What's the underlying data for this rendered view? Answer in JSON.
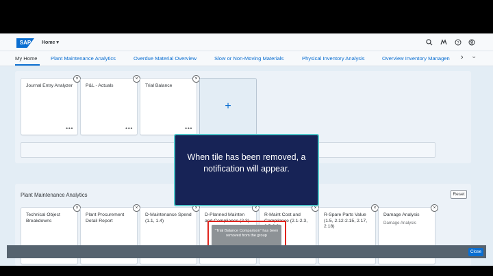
{
  "shell": {
    "logo": "SAP",
    "home_label": "Home ▾",
    "icons": [
      "search-icon",
      "feedback-icon",
      "help-icon",
      "user-icon"
    ]
  },
  "nav": {
    "tabs": [
      "My Home",
      "Plant Maintenance Analytics",
      "Overdue Material Overview",
      "Slow or Non-Moving Materials",
      "Physical Inventory Analysis",
      "Overview Inventory Managen"
    ],
    "overflow_more": "›",
    "overflow_down": "⌄"
  },
  "group1": {
    "tiles": [
      {
        "title": "Journal Entry Analyzer",
        "more": "•••"
      },
      {
        "title": "P&L - Actuals",
        "more": "•••"
      },
      {
        "title": "Trial Balance",
        "more": "•••"
      }
    ],
    "add_tile": "+"
  },
  "group2": {
    "title": "Plant Maintenance Analytics",
    "reset": "Reset",
    "tiles": [
      {
        "title": "Technical Object Breakdowns",
        "subtitle": ""
      },
      {
        "title": "Plant Procurement Detail Report",
        "subtitle": ""
      },
      {
        "title": "D-Maintenance Spend (1.1, 1.4)",
        "subtitle": ""
      },
      {
        "title": "D-Planned Mainten and Compliance (2.3)",
        "subtitle": ""
      },
      {
        "title": "R-Maint Cost and Compliance (2.1-2.3, 2.5-2.9)",
        "subtitle": ""
      },
      {
        "title": "R-Spare Parts Value (1.5, 2.12-2.15, 2.17, 2.18)",
        "subtitle": ""
      },
      {
        "title": "Damage Analysis",
        "subtitle": "Damage Analysis"
      }
    ]
  },
  "callout": {
    "text": "When tile has been removed, a notification will appear."
  },
  "toast": {
    "text": "\"Trial Balance Comparison\" has been removed from the group"
  },
  "footer": {
    "close_label": "Close"
  },
  "colors": {
    "accent": "#0a6ed1",
    "callout_bg": "#172356",
    "callout_border": "#4fc4c8",
    "highlight": "#e0241d"
  }
}
